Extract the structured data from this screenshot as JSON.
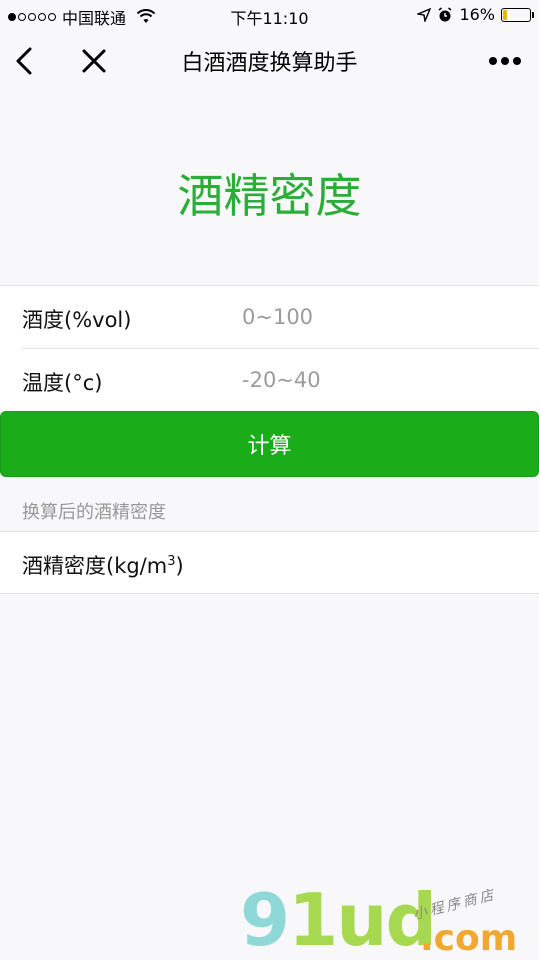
{
  "status_bar": {
    "carrier": "中国联通",
    "time": "下午11:10",
    "battery": "16%",
    "battery_level": 0.16,
    "battery_color": "#e8b800",
    "icons": [
      "signal-dots",
      "wifi-icon",
      "location-arrow-icon",
      "alarm-icon",
      "battery-icon"
    ]
  },
  "nav": {
    "title": "白酒酒度换算助手",
    "icons": [
      "back-icon",
      "close-icon",
      "more-icon"
    ]
  },
  "hero": {
    "title": "酒精密度",
    "color": "#2aae37"
  },
  "form": {
    "fields": [
      {
        "label": "酒度(%vol)",
        "placeholder": "0~100",
        "value": ""
      },
      {
        "label": "温度(°c)",
        "placeholder": "-20~40",
        "value": ""
      }
    ]
  },
  "calc_button": {
    "label": "计算",
    "color": "#1aad19"
  },
  "result": {
    "section_label": "换算后的酒精密度",
    "label": "酒精密度(kg/m",
    "label_sup": "3",
    "label_suffix": ")"
  },
  "watermark": {
    "logo": "91ud",
    "logo_g": "9",
    "logo_rest": "1ud",
    "domain": ".com",
    "tagline": "小程序商店"
  }
}
